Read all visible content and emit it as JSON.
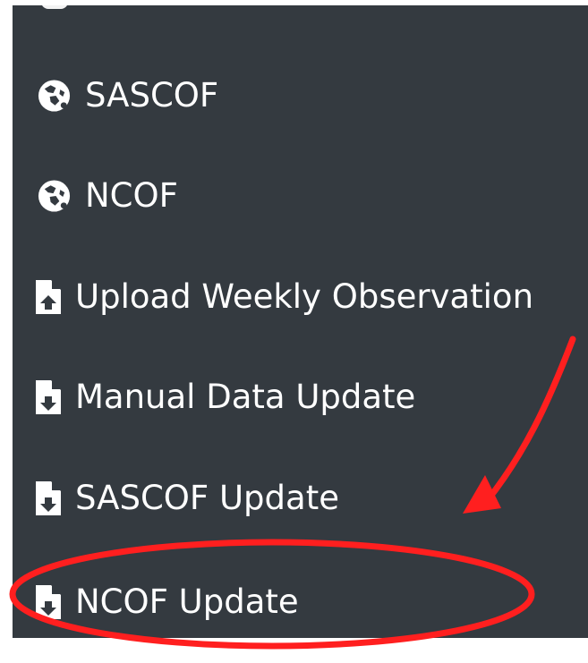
{
  "sidebar": {
    "items": [
      {
        "label": "SASCOF",
        "icon": "globe-icon"
      },
      {
        "label": "NCOF",
        "icon": "globe-icon"
      },
      {
        "label": "Upload Weekly Observation",
        "icon": "file-upload-icon"
      },
      {
        "label": "Manual Data Update",
        "icon": "file-download-icon"
      },
      {
        "label": "SASCOF Update",
        "icon": "file-download-icon"
      },
      {
        "label": "NCOF Update",
        "icon": "file-download-icon"
      }
    ]
  },
  "colors": {
    "sidebar_background": "#343a40",
    "text": "#ffffff",
    "annotation": "#ff1f1f"
  }
}
